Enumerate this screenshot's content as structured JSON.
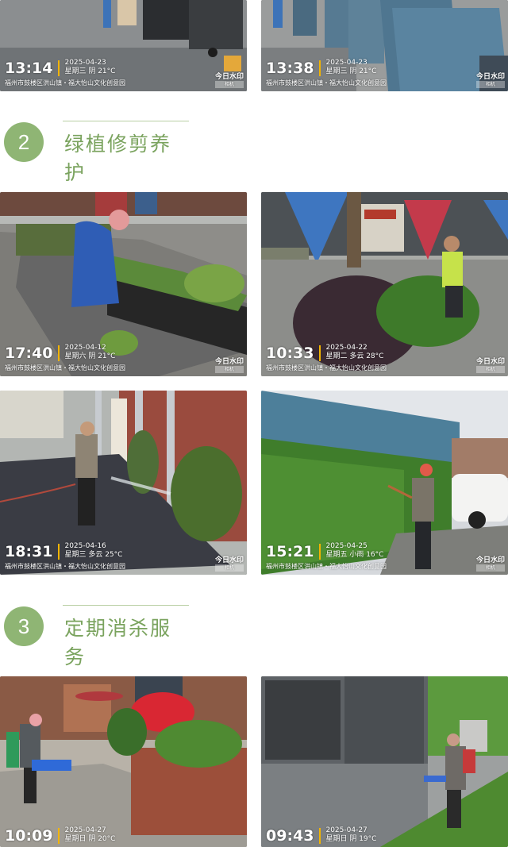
{
  "sections": [
    {
      "number": "2",
      "title": "绿植修剪养护"
    },
    {
      "number": "3",
      "title": "定期消杀服务"
    }
  ],
  "watermark": {
    "main": "今日水印",
    "sub": "相机"
  },
  "photos": [
    {
      "time": "13:14",
      "date": "2025-04-23",
      "weather": "星期三 阴 21°C",
      "location": "福州市鼓楼区洪山镇・福大怡山文化创意园"
    },
    {
      "time": "13:38",
      "date": "2025-04-23",
      "weather": "星期三 阴 21°C",
      "location": "福州市鼓楼区洪山镇・福大怡山文化创意园"
    },
    {
      "time": "17:40",
      "date": "2025-04-12",
      "weather": "星期六 阴 21°C",
      "location": "福州市鼓楼区洪山镇・福大怡山文化创意园"
    },
    {
      "time": "10:33",
      "date": "2025-04-22",
      "weather": "星期二 多云 28°C",
      "location": "福州市鼓楼区洪山镇・福大怡山文化创意园"
    },
    {
      "time": "18:31",
      "date": "2025-04-16",
      "weather": "星期三 多云 25°C",
      "location": "福州市鼓楼区洪山镇・福大怡山文化创意园"
    },
    {
      "time": "15:21",
      "date": "2025-04-25",
      "weather": "星期五 小雨 16°C",
      "location": "福州市鼓楼区洪山镇・福大怡山文化创意园"
    },
    {
      "time": "10:09",
      "date": "2025-04-27",
      "weather": "星期日 阴 20°C",
      "location": ""
    },
    {
      "time": "09:43",
      "date": "2025-04-27",
      "weather": "星期日 阴 19°C",
      "location": ""
    }
  ]
}
